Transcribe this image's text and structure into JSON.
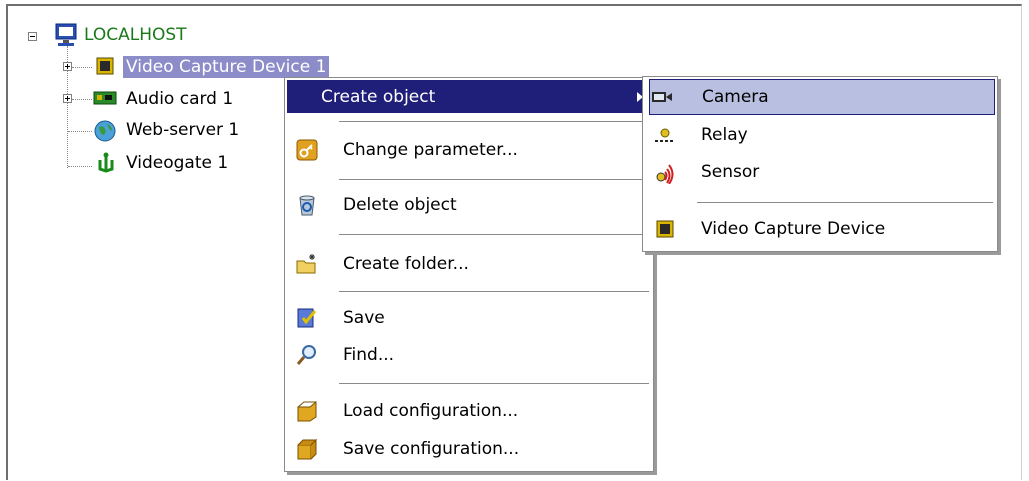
{
  "tree": {
    "root": "LOCALHOST",
    "items": [
      {
        "label": "Video Capture Device 1"
      },
      {
        "label": "Audio card 1"
      },
      {
        "label": "Web-server 1"
      },
      {
        "label": "Videogate 1"
      }
    ]
  },
  "context_menu": {
    "items": [
      {
        "label": "Create object"
      },
      {
        "label": "Change parameter..."
      },
      {
        "label": "Delete object"
      },
      {
        "label": "Create folder..."
      },
      {
        "label": "Save"
      },
      {
        "label": "Find..."
      },
      {
        "label": "Load configuration..."
      },
      {
        "label": "Save configuration..."
      }
    ]
  },
  "submenu": {
    "items": [
      {
        "label": "Camera"
      },
      {
        "label": "Relay"
      },
      {
        "label": "Sensor"
      },
      {
        "label": "Video Capture Device"
      }
    ]
  },
  "colors": {
    "selection": "#8c8cc8",
    "menu_highlight": "#1f1f7a",
    "submenu_highlight": "#b8bfe0",
    "root_text": "#1a7a1a"
  }
}
